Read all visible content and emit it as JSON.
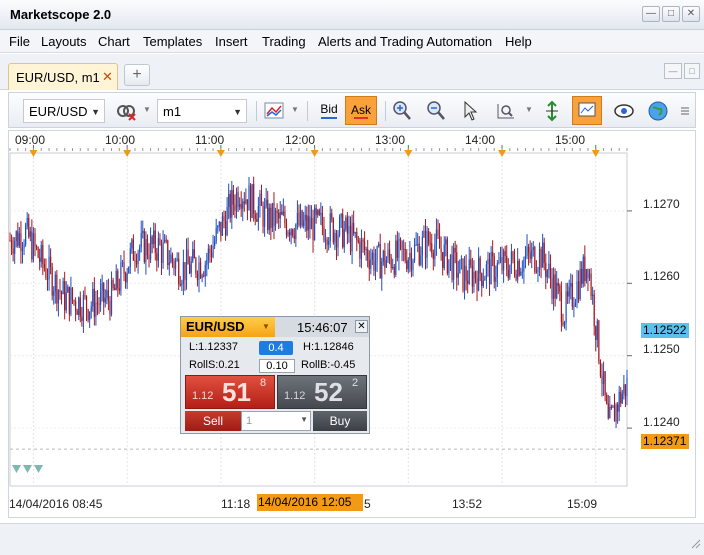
{
  "window": {
    "title": "Marketscope 2.0",
    "minimize": "—",
    "maximize": "□",
    "close": "✕"
  },
  "menu": [
    "File",
    "Layouts",
    "Chart",
    "Templates",
    "Insert",
    "Trading",
    "Alerts and Trading Automation",
    "Help"
  ],
  "tab": {
    "label": "EUR/USD, m1",
    "close": "✕",
    "add": "+"
  },
  "toolbar": {
    "symbol": "EUR/USD",
    "timeframe": "m1",
    "bid_label": "Bid",
    "ask_label": "Ask",
    "icons": [
      "chart-type-icon",
      "indicator-icon",
      "zoom-in-icon",
      "zoom-out-icon",
      "cursor-icon",
      "zoom-range-icon",
      "fit-icon",
      "snapshot-icon",
      "eye-icon",
      "globe-icon",
      "more-icon"
    ]
  },
  "chart": {
    "top_time_labels": [
      "09:00",
      "10:00",
      "11:00",
      "12:00",
      "13:00",
      "14:00",
      "15:00"
    ],
    "bottom_time_labels": [
      "14/04/2016 08:45",
      "11:18",
      "14/04/2016 12:05",
      "13:52",
      "15:09"
    ],
    "bottom_cursor_label": "14/04/2016 12:05",
    "price_labels": [
      "1.1270",
      "1.1260",
      "1.1250",
      "1.1240"
    ],
    "bid_marker": "1.12522",
    "ask_marker": "1.12371",
    "colors": {
      "up": "#1f4fbf",
      "down": "#a01820",
      "bid_marker": "#5bc0ee",
      "ask_marker": "#f39a14"
    }
  },
  "chart_data": {
    "type": "candlestick",
    "x_range": [
      "08:45",
      "15:20"
    ],
    "ylim": [
      1.1232,
      1.1278
    ],
    "close_path": [
      [
        "08:45",
        1.1266
      ],
      [
        "08:55",
        1.1267
      ],
      [
        "09:05",
        1.1263
      ],
      [
        "09:20",
        1.1258
      ],
      [
        "09:35",
        1.1257
      ],
      [
        "09:50",
        1.1258
      ],
      [
        "10:05",
        1.1265
      ],
      [
        "10:20",
        1.1265
      ],
      [
        "10:35",
        1.1262
      ],
      [
        "10:50",
        1.1263
      ],
      [
        "11:05",
        1.127
      ],
      [
        "11:12",
        1.1273
      ],
      [
        "11:30",
        1.1269
      ],
      [
        "11:50",
        1.1268
      ],
      [
        "12:05",
        1.1268
      ],
      [
        "12:20",
        1.1267
      ],
      [
        "12:40",
        1.1263
      ],
      [
        "13:00",
        1.1264
      ],
      [
        "13:15",
        1.1266
      ],
      [
        "13:35",
        1.1261
      ],
      [
        "13:55",
        1.1262
      ],
      [
        "14:10",
        1.1263
      ],
      [
        "14:25",
        1.1264
      ],
      [
        "14:40",
        1.1256
      ],
      [
        "14:55",
        1.1263
      ],
      [
        "15:03",
        1.1249
      ],
      [
        "15:08",
        1.124
      ],
      [
        "15:15",
        1.1244
      ],
      [
        "15:20",
        1.1246
      ]
    ]
  },
  "trade_panel": {
    "symbol": "EUR/USD",
    "time": "15:46:07",
    "close": "✕",
    "low": "L:1.12337",
    "spread": "0.4",
    "high": "H:1.12846",
    "roll_s": "RollS:0.21",
    "lot": "0.10",
    "roll_b": "RollB:-0.45",
    "sell_prefix": "1.12",
    "sell_big": "51",
    "sell_pip": "8",
    "buy_prefix": "1.12",
    "buy_big": "52",
    "buy_pip": "2",
    "sell_label": "Sell",
    "amount": "1",
    "buy_label": "Buy"
  }
}
